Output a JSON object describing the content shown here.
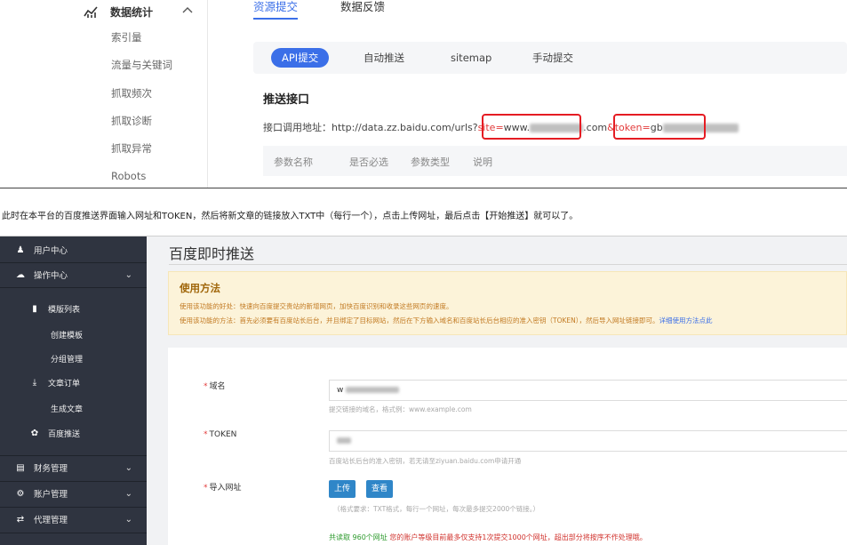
{
  "top": {
    "sidebar": {
      "section_label": "数据统计",
      "items": [
        "索引量",
        "流量与关键词",
        "抓取频次",
        "抓取诊断",
        "抓取异常",
        "Robots"
      ]
    },
    "tabs": [
      "资源提交",
      "数据反馈"
    ],
    "sub_tabs": [
      "API提交",
      "自动推送",
      "sitemap",
      "手动提交"
    ],
    "section_title": "推送接口",
    "api_line": {
      "prefix": "接口调用地址：http://data.zz.baidu.com/urls?",
      "site_key": "site=",
      "site_value_start": "www.",
      "site_value_end": ".com",
      "token_key": "&token=",
      "token_value_start": "gb"
    },
    "param_headers": [
      "参数名称",
      "是否必选",
      "参数类型",
      "说明"
    ],
    "colors": {
      "accent": "#3b6fe8",
      "highlight": "#e51c23"
    }
  },
  "caption": "此时在本平台的百度推送界面输入网址和TOKEN，然后将新文章的链接放入TXT中（每行一个），点击上传网址，最后点击【开始推送】就可以了。",
  "bottom": {
    "nav": {
      "user_center": "用户中心",
      "ops_center": "操作中心",
      "template_list": "模版列表",
      "create_template": "创建模板",
      "group_manage": "分组管理",
      "article_order": "文章订单",
      "generate_article": "生成文章",
      "baidu_push": "百度推送",
      "finance": "财务管理",
      "account": "账户管理",
      "agent": "代理管理"
    },
    "page_title": "百度即时推送",
    "usage": {
      "title": "使用方法",
      "line1": "使用该功能的好处：快速向百度提交贵站的新增网页，加快百度识别和收录这些网页的速度。",
      "line2": "使用该功能的方法：首先必须要有百度站长后台，并且绑定了目标网站，然后在下方输入域名和百度站长后台相应的准入密钥（TOKEN），然后导入网址链接即可。",
      "link": "详细使用方法点此"
    },
    "form": {
      "domain_label": "域名",
      "domain_value": "w",
      "domain_help": "提交链接的域名，格式例：www.example.com",
      "token_label": "TOKEN",
      "token_help": "百度站长后台的准入密钥，若无请至ziyuan.baidu.com申请开通",
      "import_label": "导入网址",
      "upload_button": "上传",
      "view_button": "查看",
      "import_note": "（格式要求：TXT格式，每行一个网址，每次最多提交2000个链接。）",
      "result_count": "共读取 960个网址",
      "result_warning": "您的账户等级目前最多仅支持1次提交1000个网址，超出部分将按序不作处理哦。"
    }
  }
}
